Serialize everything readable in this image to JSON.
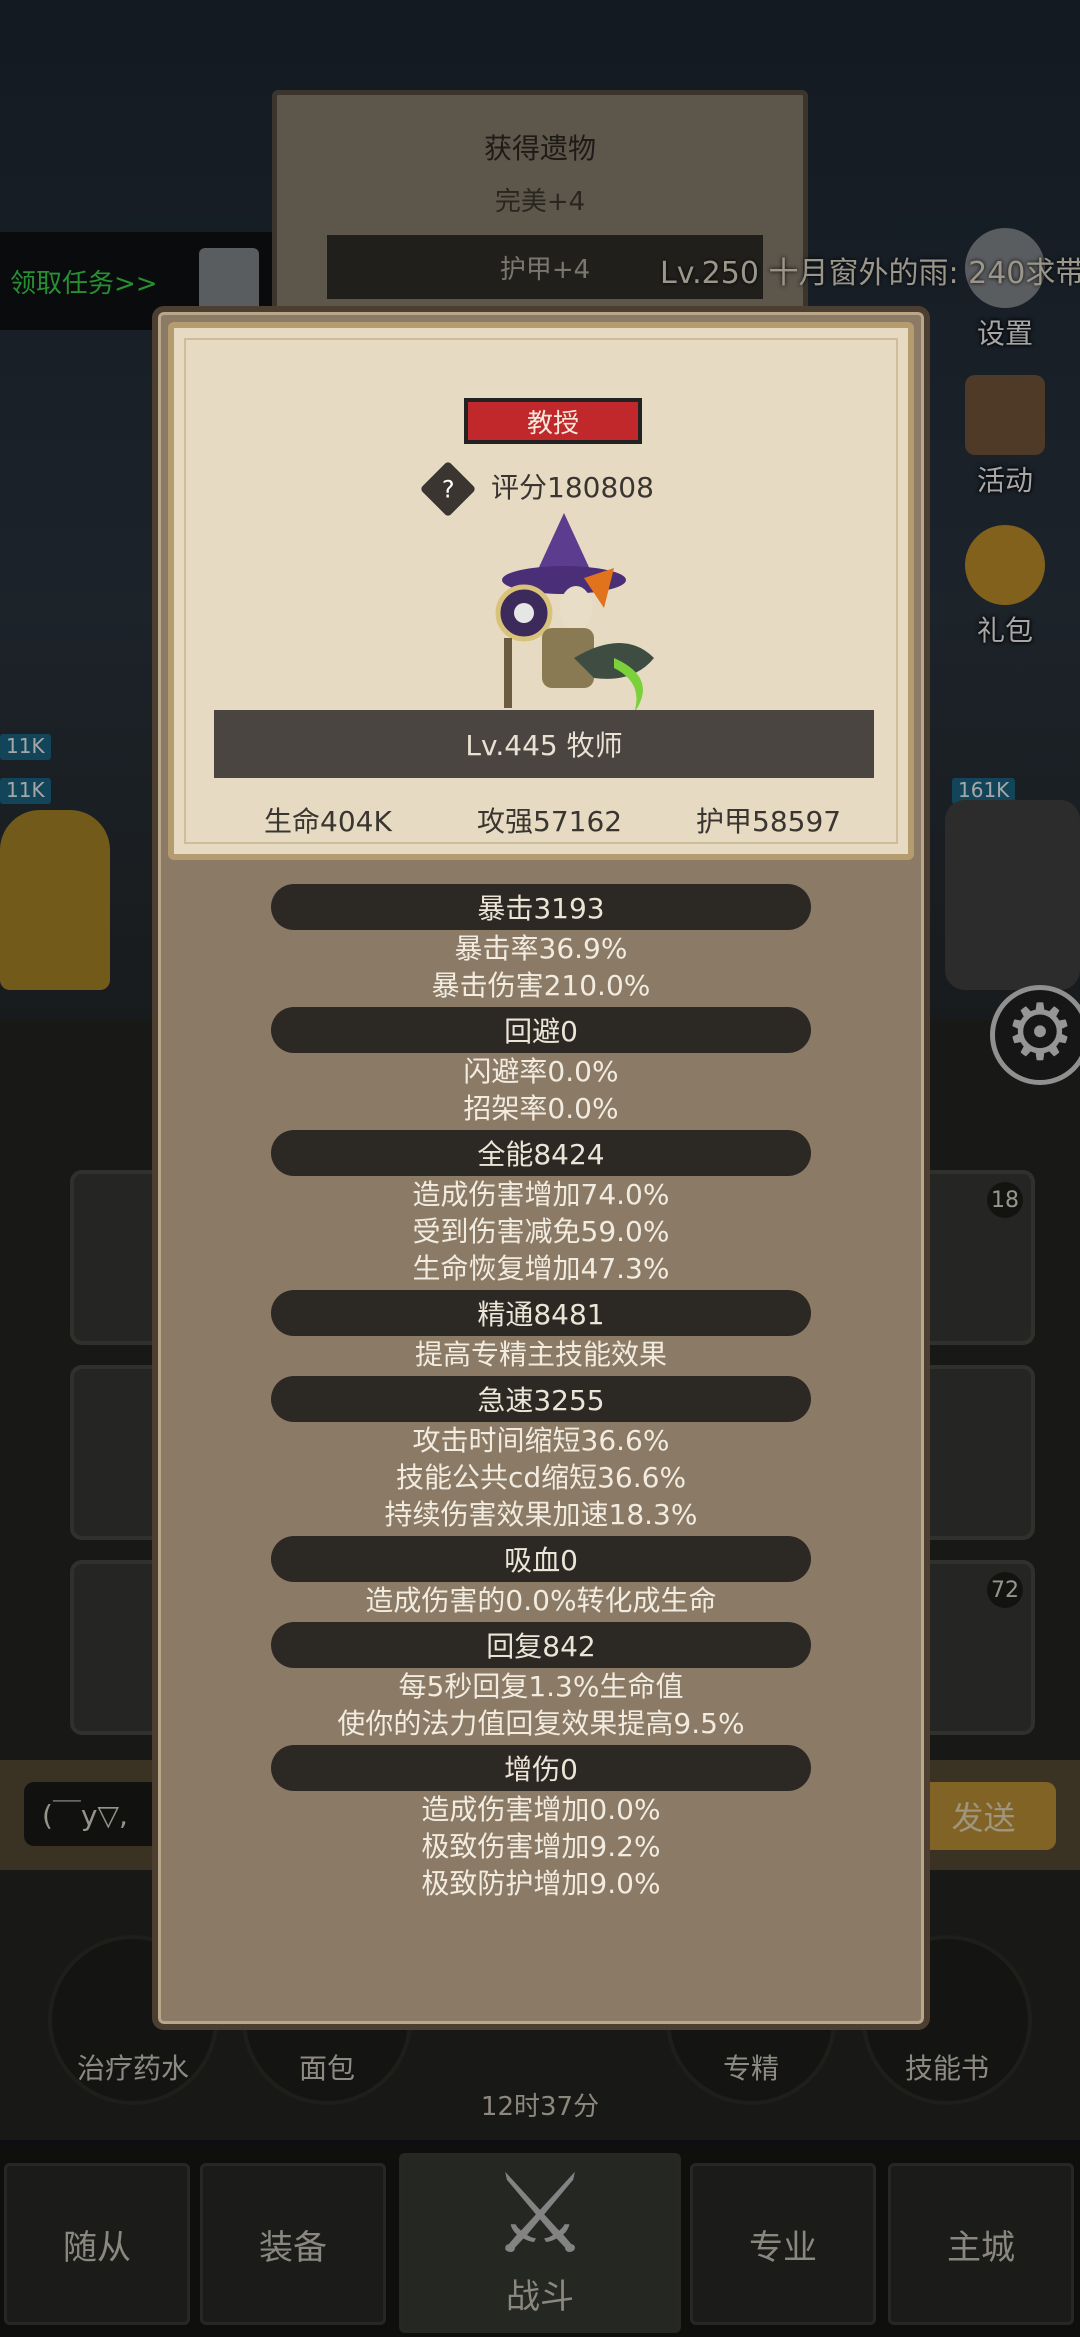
{
  "background": {
    "quest_label": "领取任务>>",
    "marquee": "Lv.250 十月窗外的雨: 240求带",
    "side_icons": [
      {
        "label": "设置",
        "icon": "gear-icon"
      },
      {
        "label": "活动",
        "icon": "scroll-icon"
      },
      {
        "label": "礼包",
        "icon": "gift-coin-icon"
      }
    ],
    "hp_left_1": "11K",
    "hp_left_2": "11K",
    "hp_right": "161K",
    "slot_num_1": "18",
    "slot_num_2": "72",
    "chat_input": "(￣y▽,",
    "send_label": "发送",
    "quick_items": [
      "治疗药水",
      "面包",
      "专精",
      "技能书"
    ],
    "timer": "12时37分",
    "nav": [
      "随从",
      "装备",
      "战斗",
      "专业",
      "主城"
    ]
  },
  "loot": {
    "title": "获得遗物",
    "quality": "完美+4",
    "item": "护甲+4"
  },
  "hero": {
    "class_badge": "教授",
    "score": "评分180808",
    "name": "Lv.445 牧师",
    "hp": "生命404K",
    "attack": "攻强57162",
    "armor": "护甲58597"
  },
  "stats": [
    {
      "header": "暴击3193",
      "lines": [
        "暴击率36.9%",
        "暴击伤害210.0%"
      ]
    },
    {
      "header": "回避0",
      "lines": [
        "闪避率0.0%",
        "招架率0.0%"
      ]
    },
    {
      "header": "全能8424",
      "lines": [
        "造成伤害增加74.0%",
        "受到伤害减免59.0%",
        "生命恢复增加47.3%"
      ]
    },
    {
      "header": "精通8481",
      "lines": [
        "提高专精主技能效果"
      ]
    },
    {
      "header": "急速3255",
      "lines": [
        "攻击时间缩短36.6%",
        "技能公共cd缩短36.6%",
        "持续伤害效果加速18.3%"
      ]
    },
    {
      "header": "吸血0",
      "lines": [
        "造成伤害的0.0%转化成生命"
      ]
    },
    {
      "header": "回复842",
      "lines": [
        "每5秒回复1.3%生命值",
        "使你的法力值回复效果提高9.5%"
      ]
    },
    {
      "header": "增伤0",
      "lines": [
        "造成伤害增加0.0%",
        "极致伤害增加9.2%",
        "极致防护增加9.0%"
      ]
    }
  ]
}
